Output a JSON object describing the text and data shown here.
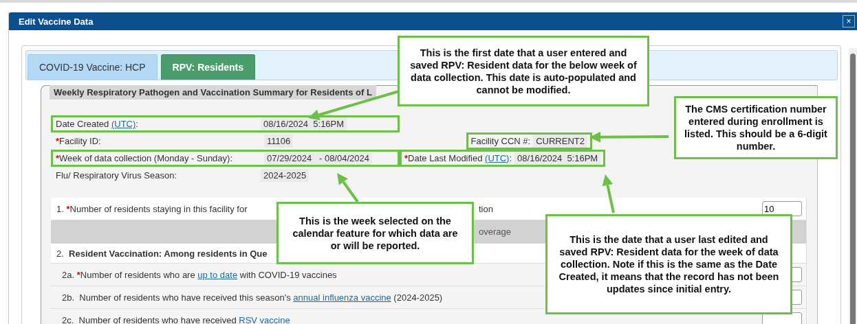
{
  "window": {
    "title": "Edit Vaccine Data",
    "close": "×"
  },
  "tabs": [
    {
      "label": "COVID-19 Vaccine: HCP",
      "selected": false
    },
    {
      "label": "RPV: Residents",
      "selected": true
    }
  ],
  "section": {
    "title": "Weekly Respiratory Pathogen and Vaccination Summary for Residents of L"
  },
  "field_rows": [
    {
      "fields": [
        {
          "label": "Date Created ",
          "link": "(UTC)",
          "suffix": ":",
          "value": "08/16/2024  5:16PM",
          "highlighted": true
        }
      ]
    },
    {
      "fields": [
        {
          "label": "Facility ID:",
          "required_mark": "*",
          "value": "11106",
          "highlighted": false
        },
        {
          "label": "Facility CCN #:",
          "value": "CURRENT2",
          "highlighted": true
        }
      ]
    },
    {
      "fields": [
        {
          "label": "Week of data collection (Monday - Sunday):",
          "required_mark": "*",
          "value": "07/29/2024   - 08/04/2024",
          "highlighted": true
        },
        {
          "label": "Date Last Modified ",
          "link": "(UTC)",
          "suffix": ":",
          "required_mark": "*",
          "value": "08/16/2024  5:16PM",
          "highlighted": true
        }
      ]
    },
    {
      "fields": [
        {
          "label": "Flu/ Respiratory Virus Season:",
          "value": "2024-2025",
          "highlighted": false
        }
      ]
    }
  ],
  "questions": [
    {
      "kind": "question",
      "number": "1.",
      "required_mark": "*",
      "text": "Number of residents staying in this facility for",
      "tail": "tion",
      "answer": "10"
    },
    {
      "kind": "band",
      "text": "overage"
    },
    {
      "kind": "heading",
      "text": "2.  **Resident Vaccination: Among residents in Que**"
    },
    {
      "kind": "subquestion",
      "number": "2a.",
      "required_mark": "*",
      "before": "Number of residents who are ",
      "link": "up to date",
      "after": " with COVID-19 vaccines"
    },
    {
      "kind": "subquestion",
      "number": "2b.",
      "before": "Number of residents who have received this season's ",
      "link": "annual influenza vaccine",
      "after": " (2024-2025)"
    },
    {
      "kind": "subquestion",
      "number": "2c.",
      "before": "Number of residents who have received ",
      "link": "RSV vaccine"
    }
  ],
  "callouts": [
    {
      "text": "This is the first date that a user entered and saved RPV: Resident data for the below week of data collection. This date is auto-populated and cannot be modified."
    },
    {
      "text": "The CMS certification number entered during enrollment is listed. This should be a 6-digit number."
    },
    {
      "text": "This is the week selected on the calendar feature for which data are or will be reported."
    },
    {
      "text": "This is the date that a user last edited and saved RPV: Resident data for the week of data collection. Note if this is the same as the Date Created, it means that the record has not been updates since initial entry."
    }
  ]
}
